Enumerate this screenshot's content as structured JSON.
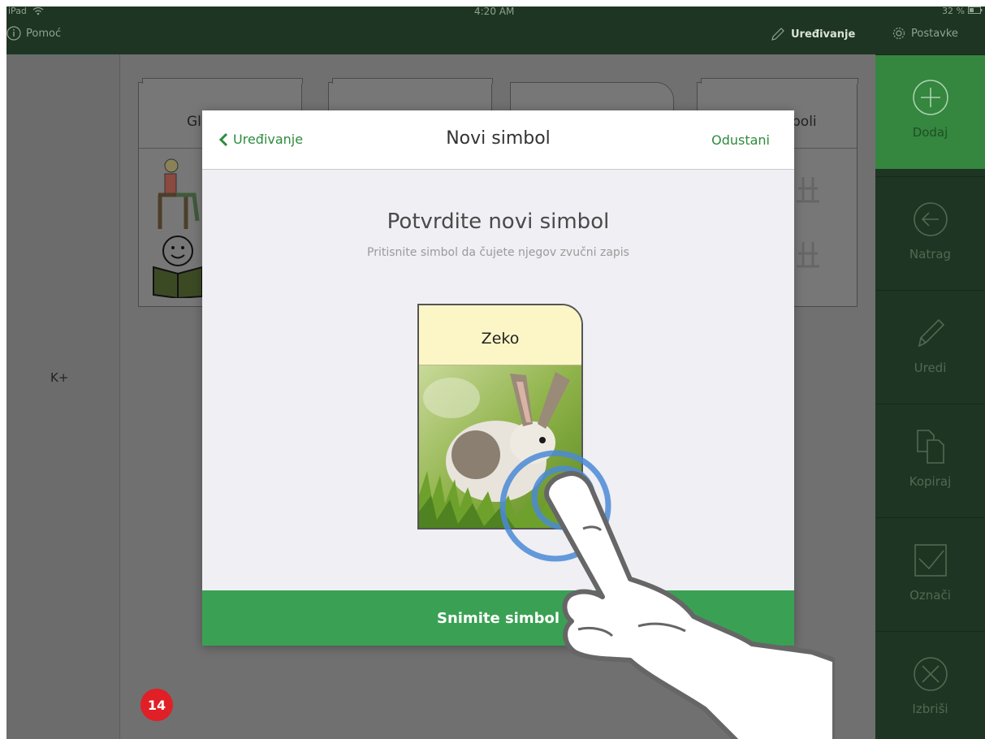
{
  "status_bar": {
    "device": "iPad",
    "time": "4:20 AM",
    "battery": "32 %"
  },
  "top_bar": {
    "help_label": "Pomoć",
    "edit_label": "Uređivanje",
    "settings_label": "Postavke"
  },
  "background": {
    "cards": [
      {
        "title": "Gl"
      },
      {
        "title": ""
      },
      {
        "title": ""
      },
      {
        "title": "boli"
      }
    ],
    "left_label": "K+"
  },
  "sidebar": {
    "items": [
      {
        "label": "Dodaj",
        "icon": "plus-circle-icon"
      },
      {
        "label": "Natrag",
        "icon": "back-arrow-icon"
      },
      {
        "label": "Uredi",
        "icon": "pencil-icon"
      },
      {
        "label": "Kopiraj",
        "icon": "copy-icon"
      },
      {
        "label": "Označi",
        "icon": "checkbox-icon"
      },
      {
        "label": "Izbriši",
        "icon": "delete-circle-icon"
      }
    ]
  },
  "modal": {
    "back_label": "Uređivanje",
    "title": "Novi simbol",
    "cancel_label": "Odustani",
    "confirm_title": "Potvrdite novi simbol",
    "confirm_subtitle": "Pritisnite simbol da čujete njegov zvučni zapis",
    "symbol_label": "Zeko",
    "record_label": "Snimite simbol"
  },
  "badge": "14",
  "colors": {
    "brand_green": "#3aa154",
    "dark_green": "#1e3523",
    "badge_red": "#e01f26",
    "card_yellow": "#fcf6c7"
  }
}
